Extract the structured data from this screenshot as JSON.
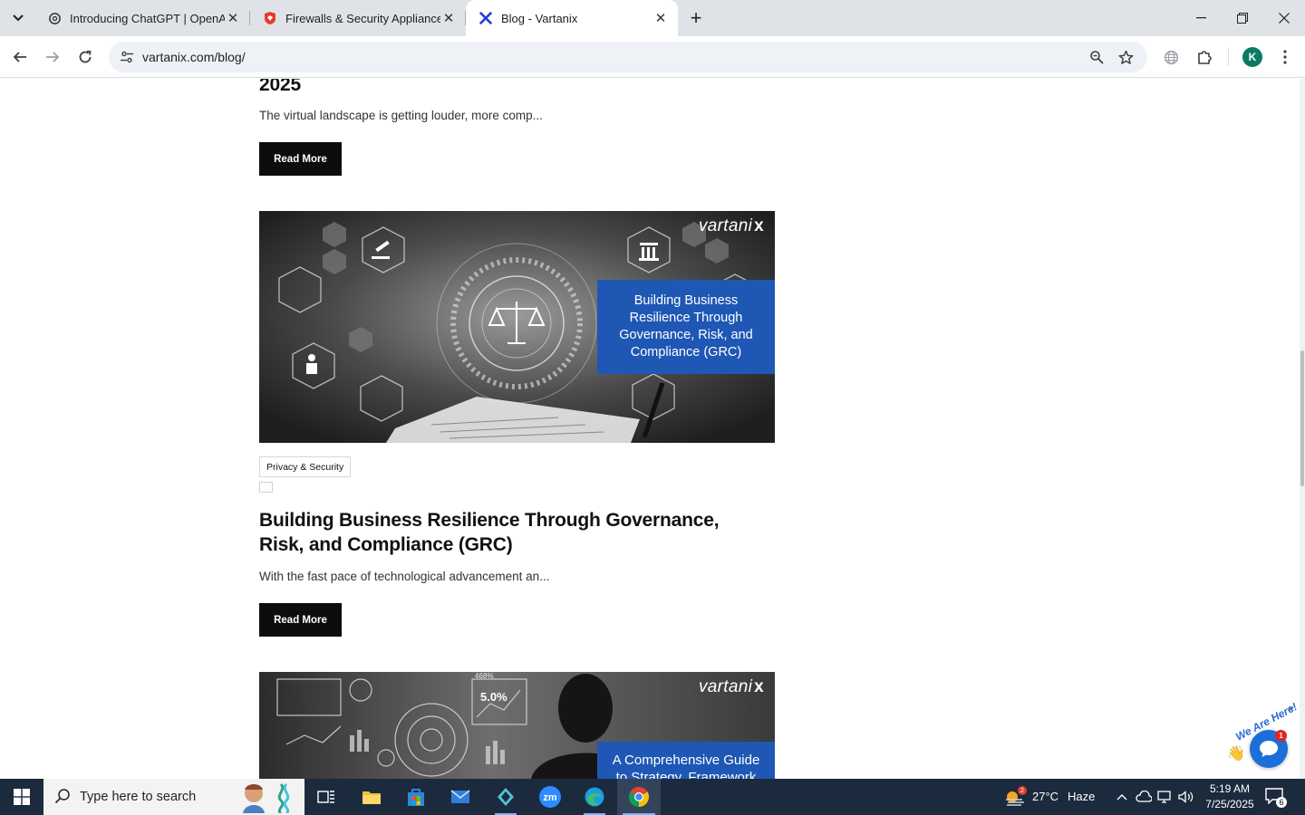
{
  "browser": {
    "tabs": [
      {
        "title": "Introducing ChatGPT | OpenAI",
        "icon": "openai-icon",
        "active": false
      },
      {
        "title": "Firewalls & Security Appliances",
        "icon": "fortinet-icon",
        "active": false
      },
      {
        "title": "Blog - Vartanix",
        "icon": "vartanix-icon",
        "active": true
      }
    ],
    "url": "vartanix.com/blog/",
    "profile_initial": "K",
    "window_controls": [
      "minimize",
      "restore",
      "close"
    ]
  },
  "page": {
    "partial_post": {
      "title_tail": "2025",
      "excerpt": "The virtual landscape is getting louder, more comp...",
      "read_more": "Read More"
    },
    "post": {
      "image_logo": "vartani",
      "image_logo_x": "x",
      "image_caption": "Building Business Resilience Through Governance, Risk, and Compliance (GRC)",
      "category": "Privacy & Security",
      "title": "Building Business Resilience Through Governance, Risk, and Compliance (GRC)",
      "excerpt": "With the fast pace of technological advancement an...",
      "read_more": "Read More"
    },
    "next_post": {
      "image_logo": "vartani",
      "image_logo_x": "x",
      "image_caption": "A Comprehensive Guide to Strategy, Framework",
      "stat_text": "5.0%",
      "stat_small": "468%"
    },
    "chat_widget": {
      "label": "We Are Here!",
      "unread": "1",
      "close": "×"
    }
  },
  "taskbar": {
    "search_placeholder": "Type here to search",
    "weather_temp": "27°C",
    "weather_desc": "Haze",
    "weather_badge": "2",
    "time": "5:19 AM",
    "date": "7/25/2025",
    "notification_count": "6"
  }
}
